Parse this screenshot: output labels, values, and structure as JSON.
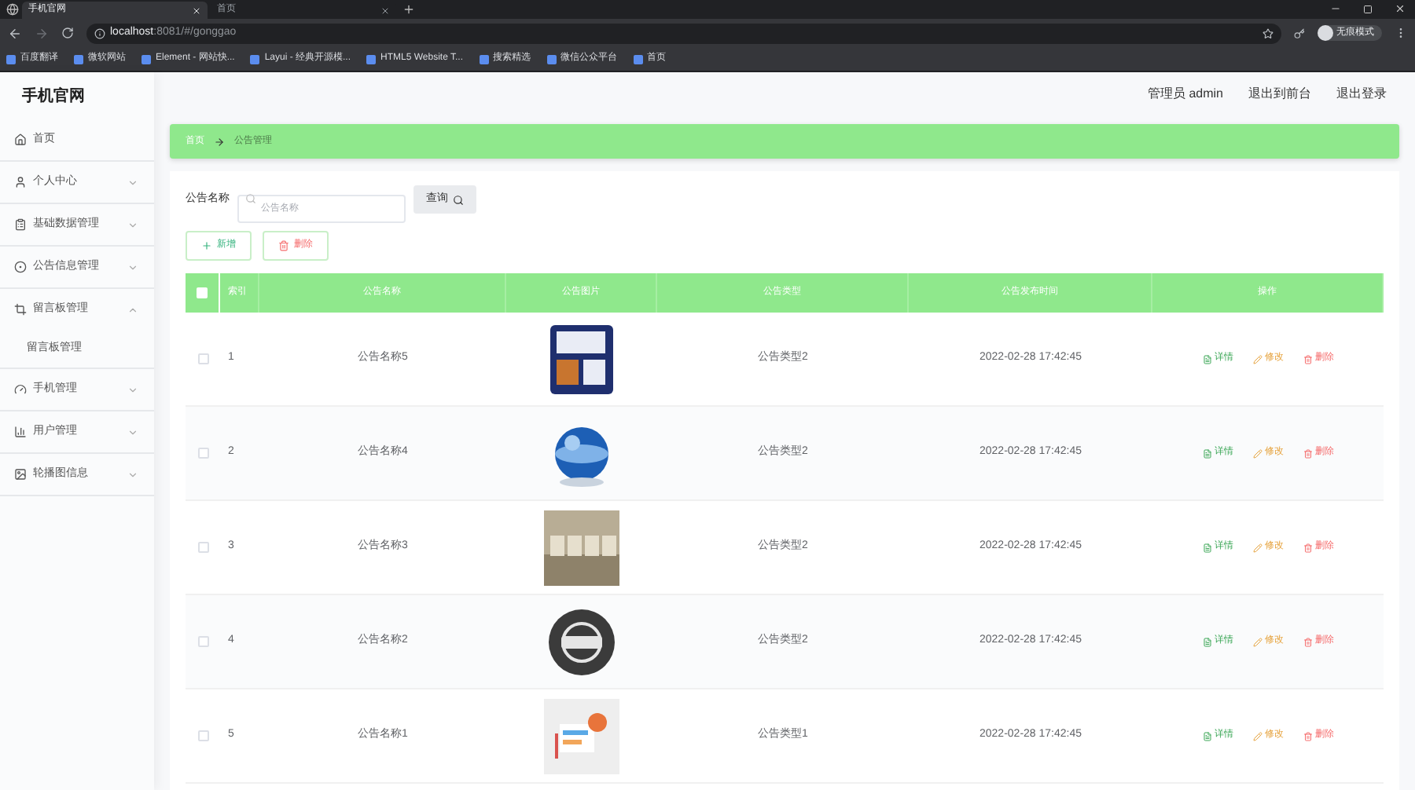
{
  "browser": {
    "tabs": [
      {
        "title": "手机官网",
        "selected": true
      },
      {
        "title": "首页",
        "selected": false
      }
    ],
    "address": {
      "host": "localhost",
      "rest": ":8081/#/gonggao"
    },
    "profile": "无痕模式",
    "bookmarks": [
      "百度翻译",
      "微软网站",
      "Element - 网站快...",
      "Layui - 经典开源模...",
      "HTML5 Website T...",
      "搜索精选",
      "微信公众平台",
      "首页"
    ]
  },
  "app": {
    "logo": "手机官网",
    "header_links": [
      "管理员 admin",
      "退出到前台",
      "退出登录"
    ]
  },
  "sidebar": [
    {
      "label": "首页",
      "kind": "link"
    },
    {
      "label": "个人中心",
      "kind": "group",
      "expanded": false
    },
    {
      "label": "基础数据管理",
      "kind": "group",
      "expanded": false
    },
    {
      "label": "公告信息管理",
      "kind": "group",
      "expanded": false
    },
    {
      "label": "留言板管理",
      "kind": "group",
      "expanded": true,
      "children": [
        {
          "label": "留言板管理"
        }
      ]
    },
    {
      "label": "手机管理",
      "kind": "group",
      "expanded": false
    },
    {
      "label": "用户管理",
      "kind": "group",
      "expanded": false
    },
    {
      "label": "轮播图信息",
      "kind": "group",
      "expanded": false
    }
  ],
  "breadcrumb": [
    "首页",
    "公告管理"
  ],
  "search": {
    "label": "公告名称",
    "placeholder": "公告名称",
    "button": "查询"
  },
  "actions": [
    {
      "label": "新增",
      "kind": "add"
    },
    {
      "label": "删除",
      "kind": "delete"
    }
  ],
  "table": {
    "all_checked": false,
    "columns": [
      "索引",
      "公告名称",
      "公告图片",
      "公告类型",
      "公告发布时间",
      "操作"
    ],
    "rows": [
      {
        "index": "1",
        "name": "公告名称5",
        "type": "公告类型2",
        "time": "2022-02-28 17:42:45",
        "checked": false,
        "ops": [
          "详情",
          "修改",
          "删除"
        ]
      },
      {
        "index": "2",
        "name": "公告名称4",
        "type": "公告类型2",
        "time": "2022-02-28 17:42:45",
        "checked": false,
        "ops": [
          "详情",
          "修改",
          "删除"
        ]
      },
      {
        "index": "3",
        "name": "公告名称3",
        "type": "公告类型2",
        "time": "2022-02-28 17:42:45",
        "checked": false,
        "ops": [
          "详情",
          "修改",
          "删除"
        ]
      },
      {
        "index": "4",
        "name": "公告名称2",
        "type": "公告类型2",
        "time": "2022-02-28 17:42:45",
        "checked": false,
        "ops": [
          "详情",
          "修改",
          "删除"
        ]
      },
      {
        "index": "5",
        "name": "公告名称1",
        "type": "公告类型1",
        "time": "2022-02-28 17:42:45",
        "checked": false,
        "ops": [
          "详情",
          "修改",
          "删除"
        ]
      }
    ]
  }
}
